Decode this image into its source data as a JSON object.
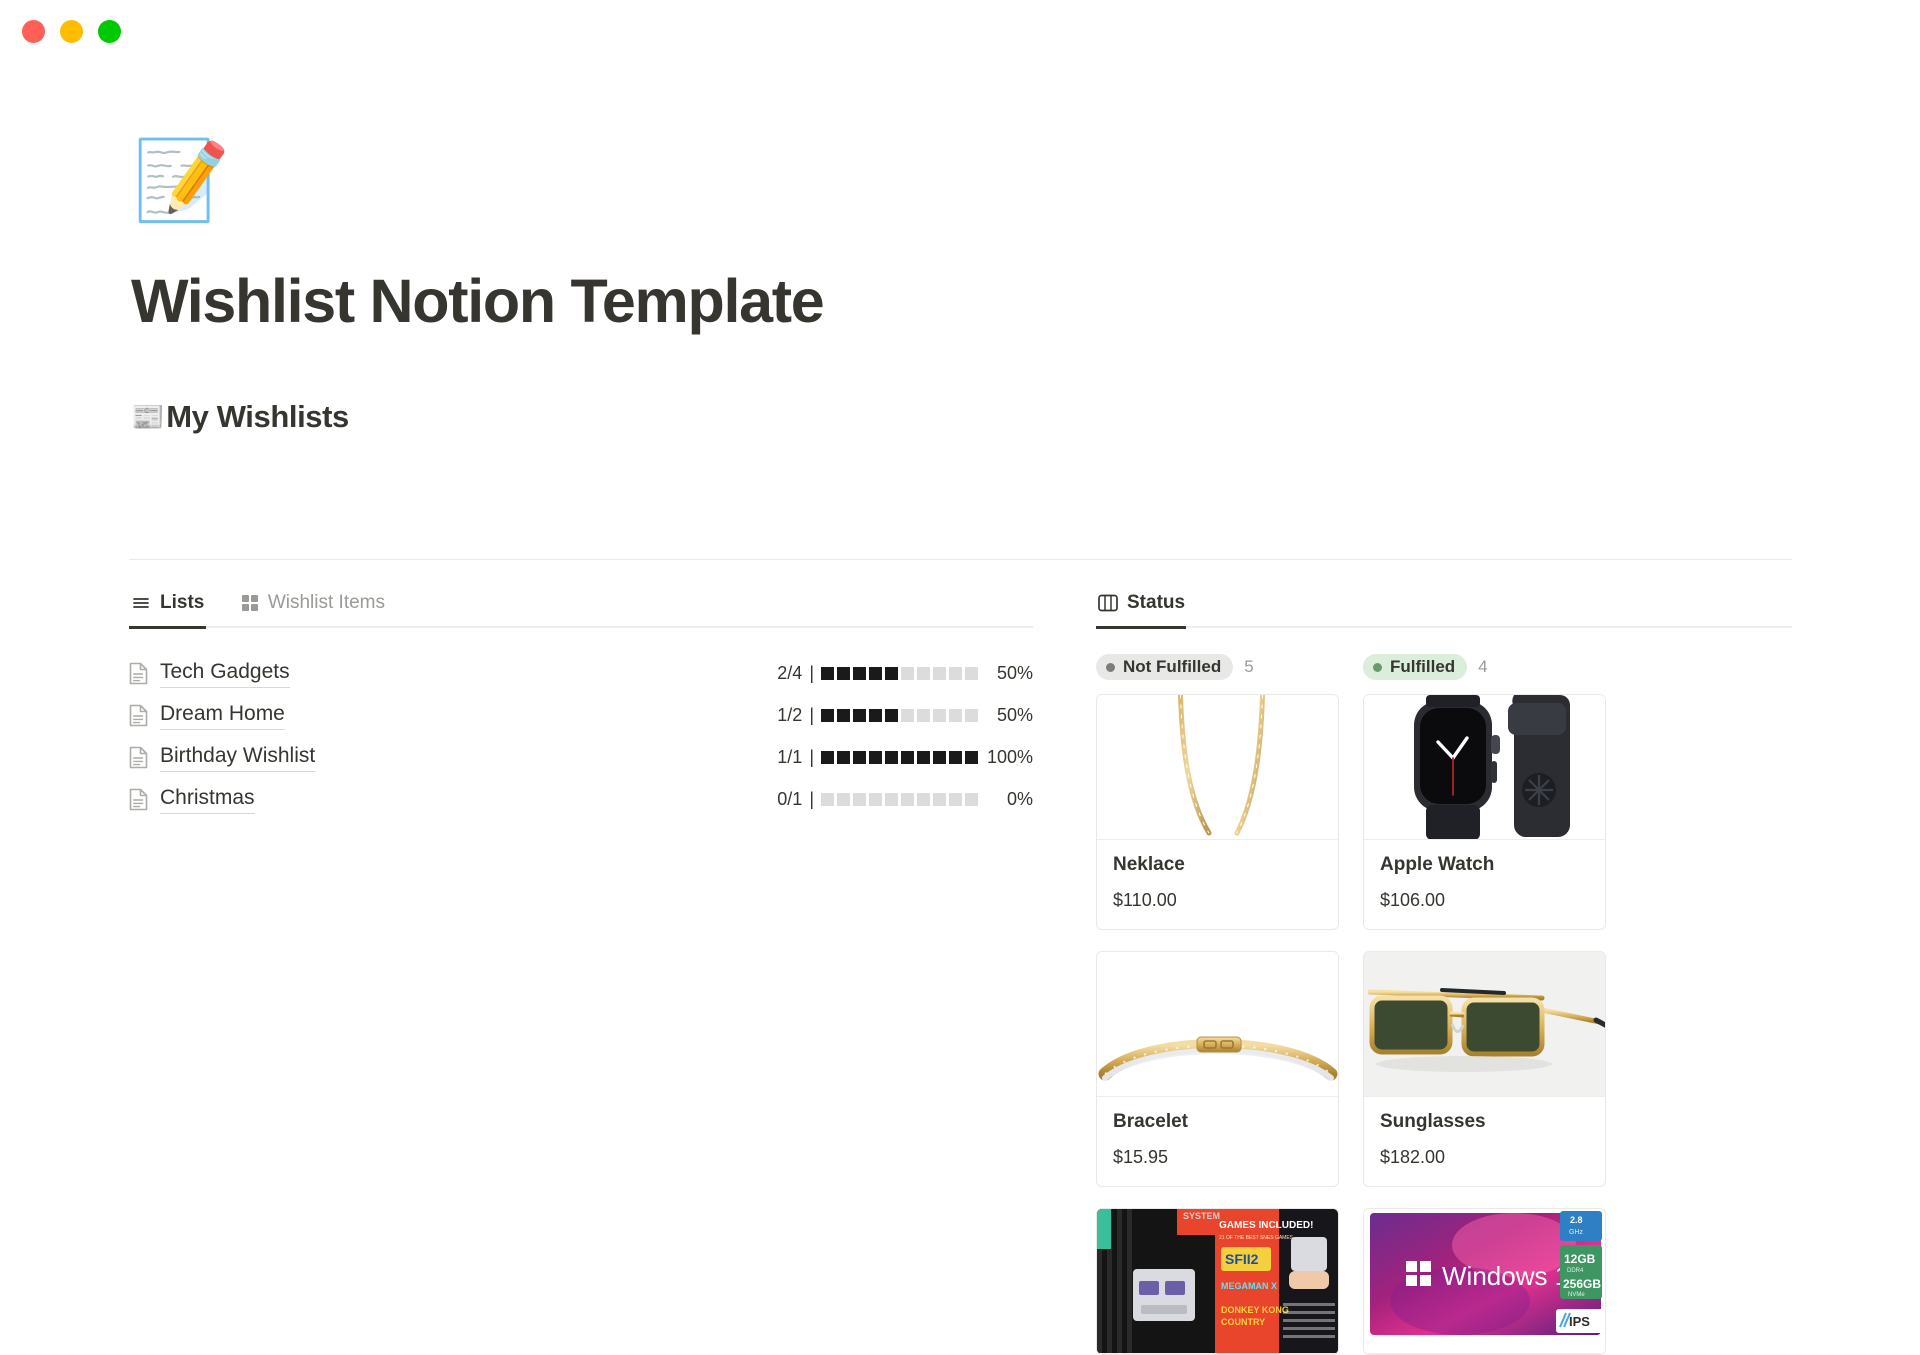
{
  "window": {
    "traffic_lights": [
      {
        "name": "close-button",
        "color": "#ff5f57"
      },
      {
        "name": "minimize-button",
        "color": "#ffbd00"
      },
      {
        "name": "maximize-button",
        "color": "#00c900"
      }
    ]
  },
  "page": {
    "icon": "📝",
    "icon_name": "memo-emoji",
    "title": "Wishlist Notion Template"
  },
  "section": {
    "emoji": "📰",
    "emoji_name": "newspaper-emoji",
    "heading": "My Wishlists"
  },
  "left_panel": {
    "tabs": [
      {
        "label": "Lists",
        "icon": "list-icon",
        "active": true
      },
      {
        "label": "Wishlist Items",
        "icon": "gallery-icon",
        "active": false
      }
    ],
    "lists": [
      {
        "name": "Tech Gadgets",
        "fraction": "2/4",
        "percent_label": "50%",
        "percent": 50,
        "blocks_total": 10,
        "blocks_filled": 5
      },
      {
        "name": "Dream Home",
        "fraction": "1/2",
        "percent_label": "50%",
        "percent": 50,
        "blocks_total": 10,
        "blocks_filled": 5
      },
      {
        "name": "Birthday Wishlist",
        "fraction": "1/1",
        "percent_label": "100%",
        "percent": 100,
        "blocks_total": 10,
        "blocks_filled": 10
      },
      {
        "name": "Christmas",
        "fraction": "0/1",
        "percent_label": "0%",
        "percent": 0,
        "blocks_total": 10,
        "blocks_filled": 0
      }
    ],
    "progress_separator": "|"
  },
  "right_panel": {
    "tabs": [
      {
        "label": "Status",
        "icon": "board-icon",
        "active": true
      }
    ],
    "groups": [
      {
        "label": "Not Fulfilled",
        "count": "5",
        "pill_bg": "#e8e8e6",
        "dot_color": "#7d7c78",
        "cards": [
          {
            "title": "Neklace",
            "price": "$110.00",
            "image": "gold-necklace-image",
            "tinted": false,
            "partial": false
          },
          {
            "title": "Bracelet",
            "price": "$15.95",
            "image": "gold-bracelet-image",
            "tinted": false,
            "partial": false
          },
          {
            "title": "",
            "price": "",
            "image": "snes-classic-box-image",
            "tinted": false,
            "partial": true
          }
        ]
      },
      {
        "label": "Fulfilled",
        "count": "4",
        "pill_bg": "#dbeddb",
        "dot_color": "#6c9a6c",
        "cards": [
          {
            "title": "Apple Watch",
            "price": "$106.00",
            "image": "apple-watch-image",
            "tinted": false,
            "partial": false
          },
          {
            "title": "Sunglasses",
            "price": "$182.00",
            "image": "sunglasses-image",
            "tinted": true,
            "partial": false
          },
          {
            "title": "",
            "price": "",
            "image": "windows-laptop-image",
            "tinted": false,
            "partial": true
          }
        ]
      }
    ]
  },
  "colors": {
    "text": "#37352f",
    "muted": "#9b9a97",
    "divider": "#e9e9e7",
    "progress_on": "#1a1a1a",
    "progress_off": "#dcdcdc",
    "fulfilled_green": "#dbeddb"
  }
}
